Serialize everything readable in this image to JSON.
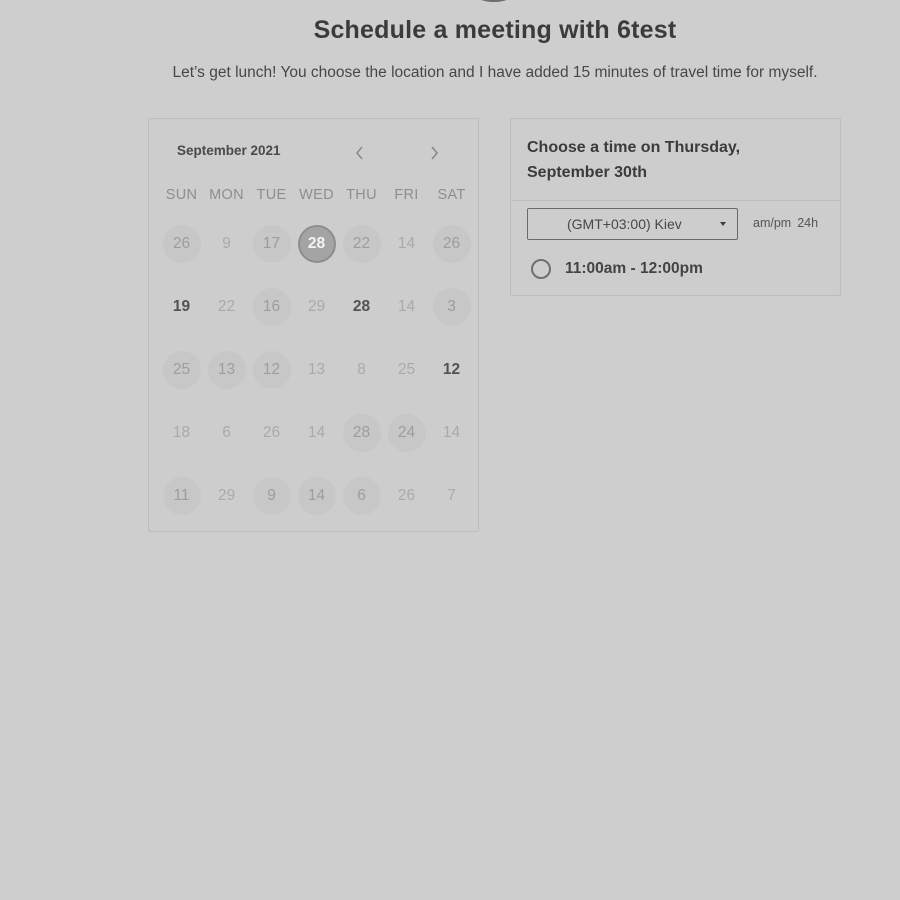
{
  "header": {
    "title": "Schedule a meeting with 6test",
    "description": "Let’s get lunch! You choose the location and I have added 15 minutes of travel time for myself."
  },
  "calendar": {
    "month_label": "September 2021",
    "prev_icon": "chevron-left-icon",
    "next_icon": "chevron-right-icon",
    "weekdays": [
      "SUN",
      "MON",
      "TUE",
      "WED",
      "THU",
      "FRI",
      "SAT"
    ],
    "weeks": [
      [
        {
          "label": "26",
          "state": "available"
        },
        {
          "label": "9",
          "state": "muted"
        },
        {
          "label": "17",
          "state": "available"
        },
        {
          "label": "28",
          "state": "selected"
        },
        {
          "label": "22",
          "state": "available"
        },
        {
          "label": "14",
          "state": "muted"
        },
        {
          "label": "26",
          "state": "available"
        }
      ],
      [
        {
          "label": "19",
          "state": "bold"
        },
        {
          "label": "22",
          "state": "muted"
        },
        {
          "label": "16",
          "state": "available"
        },
        {
          "label": "29",
          "state": "muted"
        },
        {
          "label": "28",
          "state": "bold"
        },
        {
          "label": "14",
          "state": "muted"
        },
        {
          "label": "3",
          "state": "available"
        }
      ],
      [
        {
          "label": "25",
          "state": "available"
        },
        {
          "label": "13",
          "state": "available"
        },
        {
          "label": "12",
          "state": "available"
        },
        {
          "label": "13",
          "state": "muted"
        },
        {
          "label": "8",
          "state": "muted"
        },
        {
          "label": "25",
          "state": "muted"
        },
        {
          "label": "12",
          "state": "bold"
        }
      ],
      [
        {
          "label": "18",
          "state": "muted"
        },
        {
          "label": "6",
          "state": "muted"
        },
        {
          "label": "26",
          "state": "muted"
        },
        {
          "label": "14",
          "state": "muted"
        },
        {
          "label": "28",
          "state": "available"
        },
        {
          "label": "24",
          "state": "available"
        },
        {
          "label": "14",
          "state": "muted"
        }
      ],
      [
        {
          "label": "11",
          "state": "available"
        },
        {
          "label": "29",
          "state": "muted"
        },
        {
          "label": "9",
          "state": "available"
        },
        {
          "label": "14",
          "state": "available"
        },
        {
          "label": "6",
          "state": "available"
        },
        {
          "label": "26",
          "state": "muted"
        },
        {
          "label": "7",
          "state": "muted"
        }
      ]
    ]
  },
  "times": {
    "heading": "Choose a time on Thursday, September 30th",
    "timezone": {
      "value": "(GMT+03:00) Kiev",
      "icon": "dropdown-caret-icon"
    },
    "format_options": [
      "am/pm",
      "24h"
    ],
    "slots": [
      {
        "label": "11:00am - 12:00pm"
      }
    ]
  },
  "colors": {
    "background": "#cecece",
    "selected_day": "#a4a4a4",
    "text_primary": "#3b3b3b"
  }
}
